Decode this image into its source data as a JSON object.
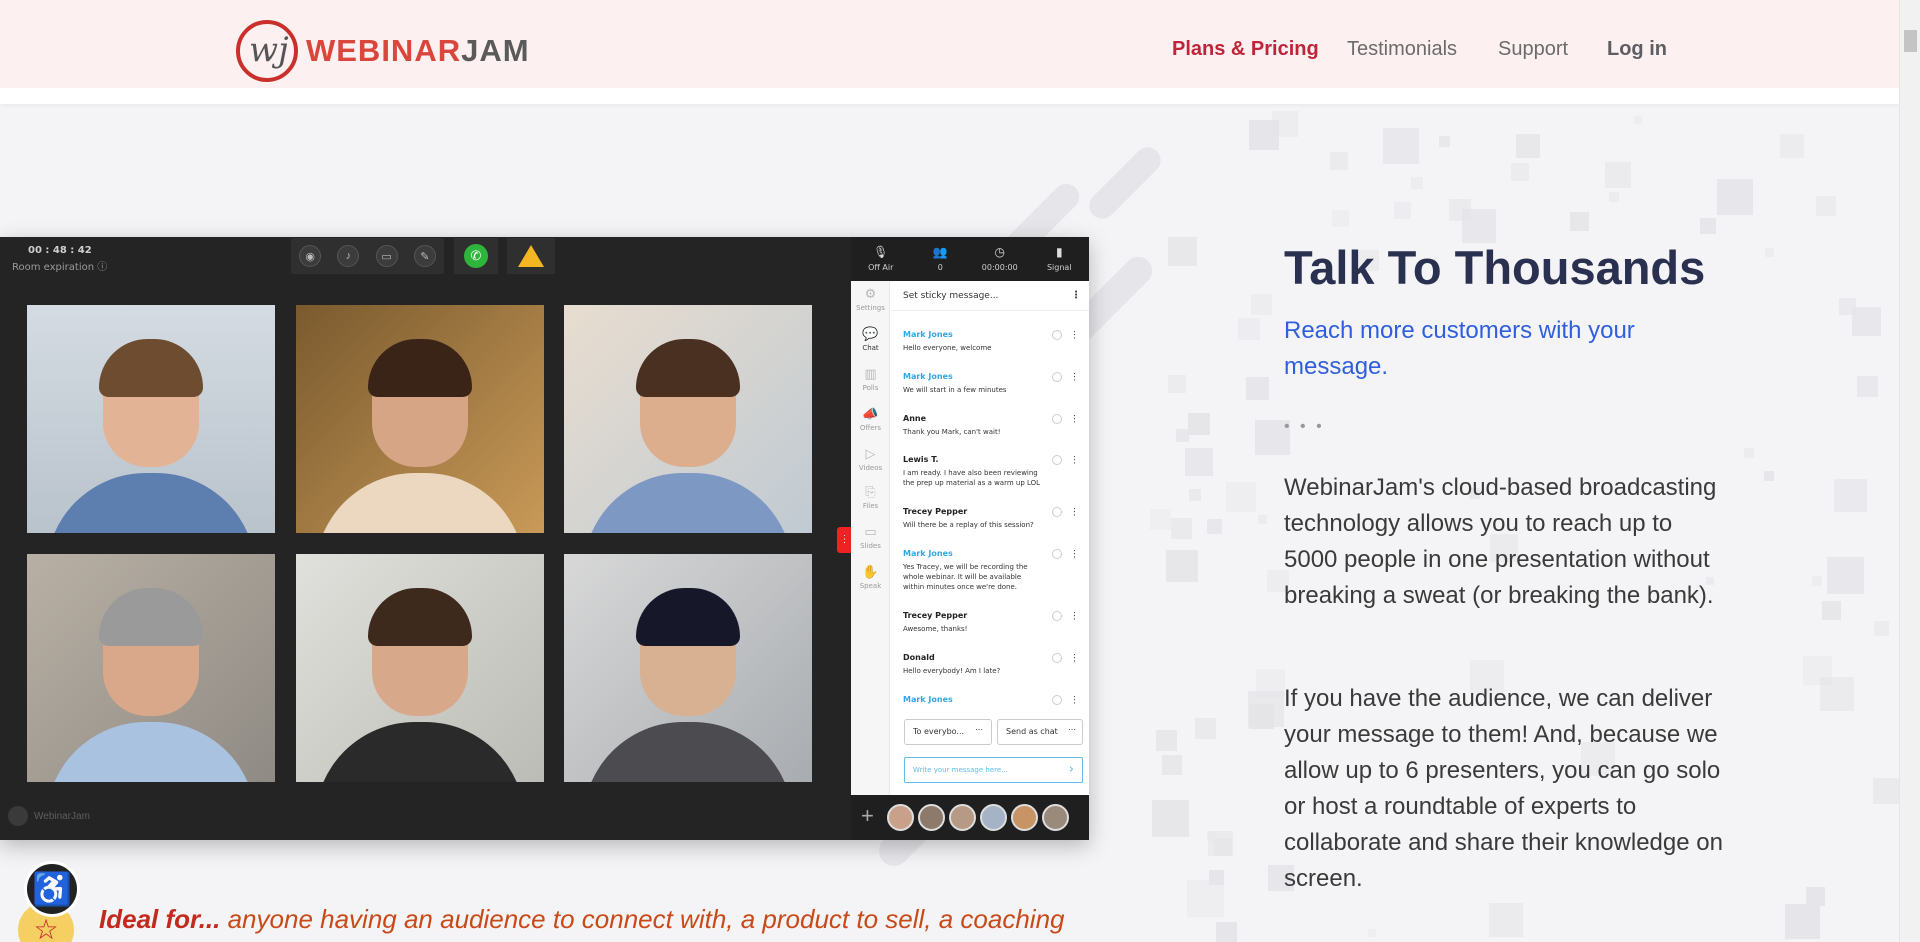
{
  "header": {
    "logo_text_a": "WEBINAR",
    "logo_text_b": "JAM",
    "logo_mark": "wj",
    "nav": [
      "Plans & Pricing",
      "Testimonials",
      "Support",
      "Log in"
    ]
  },
  "webinar": {
    "timer": "00 : 48 : 42",
    "expiry_label": "Room expiration",
    "brand_footer": "WebinarJam",
    "stats": [
      {
        "label": "Off Air"
      },
      {
        "label": "0"
      },
      {
        "label": "00:00:00"
      },
      {
        "label": "Signal"
      }
    ],
    "rail": [
      "Settings",
      "Chat",
      "Polls",
      "Offers",
      "Videos",
      "Files",
      "Slides",
      "Speak"
    ],
    "sticky_placeholder": "Set sticky message...",
    "messages": [
      {
        "name": "Mark Jones",
        "text": "Hello everyone, welcome"
      },
      {
        "name": "Mark Jones",
        "text": "We will start in a few minutes"
      },
      {
        "name": "Anne",
        "text": "Thank you Mark, can't wait!"
      },
      {
        "name": "Lewis T.",
        "text": "I am ready. I have also been reviewing the prep up material as a warm up LOL"
      },
      {
        "name": "Trecey Pepper",
        "text": "Will there be a replay of this session?"
      },
      {
        "name": "Mark Jones",
        "text": "Yes Tracey, we will be recording the whole webinar. It will be available within minutes once we're done."
      },
      {
        "name": "Trecey Pepper",
        "text": "Awesome, thanks!"
      },
      {
        "name": "Donald",
        "text": "Hello everybody! Am I late?"
      },
      {
        "name": "Mark Jones",
        "text": ""
      }
    ],
    "to_select": "To everybo...",
    "send_select": "Send as chat",
    "write_placeholder": "Write your message here..."
  },
  "content": {
    "title": "Talk To Thousands",
    "subtitle": "Reach more customers with your message.",
    "ellipsis": "• • •",
    "para1": "WebinarJam's cloud-based broadcasting technology allows you to reach up to 5000 people in one presentation without breaking a sweat (or breaking the bank).",
    "para2": "If you have the audience, we can deliver your message to them! And, because we allow up to 6 presenters, you can go solo or host a roundtable of experts to collaborate and share their knowledge on screen."
  },
  "ideal": {
    "lead": "Ideal for...",
    "text": " anyone having an audience to connect with, a product to sell, a coaching"
  },
  "colors": {
    "brand_red": "#c0243a",
    "subtitle_blue": "#2f5fdc",
    "title_navy": "#2a3050",
    "chat_host": "#30a8e0"
  }
}
